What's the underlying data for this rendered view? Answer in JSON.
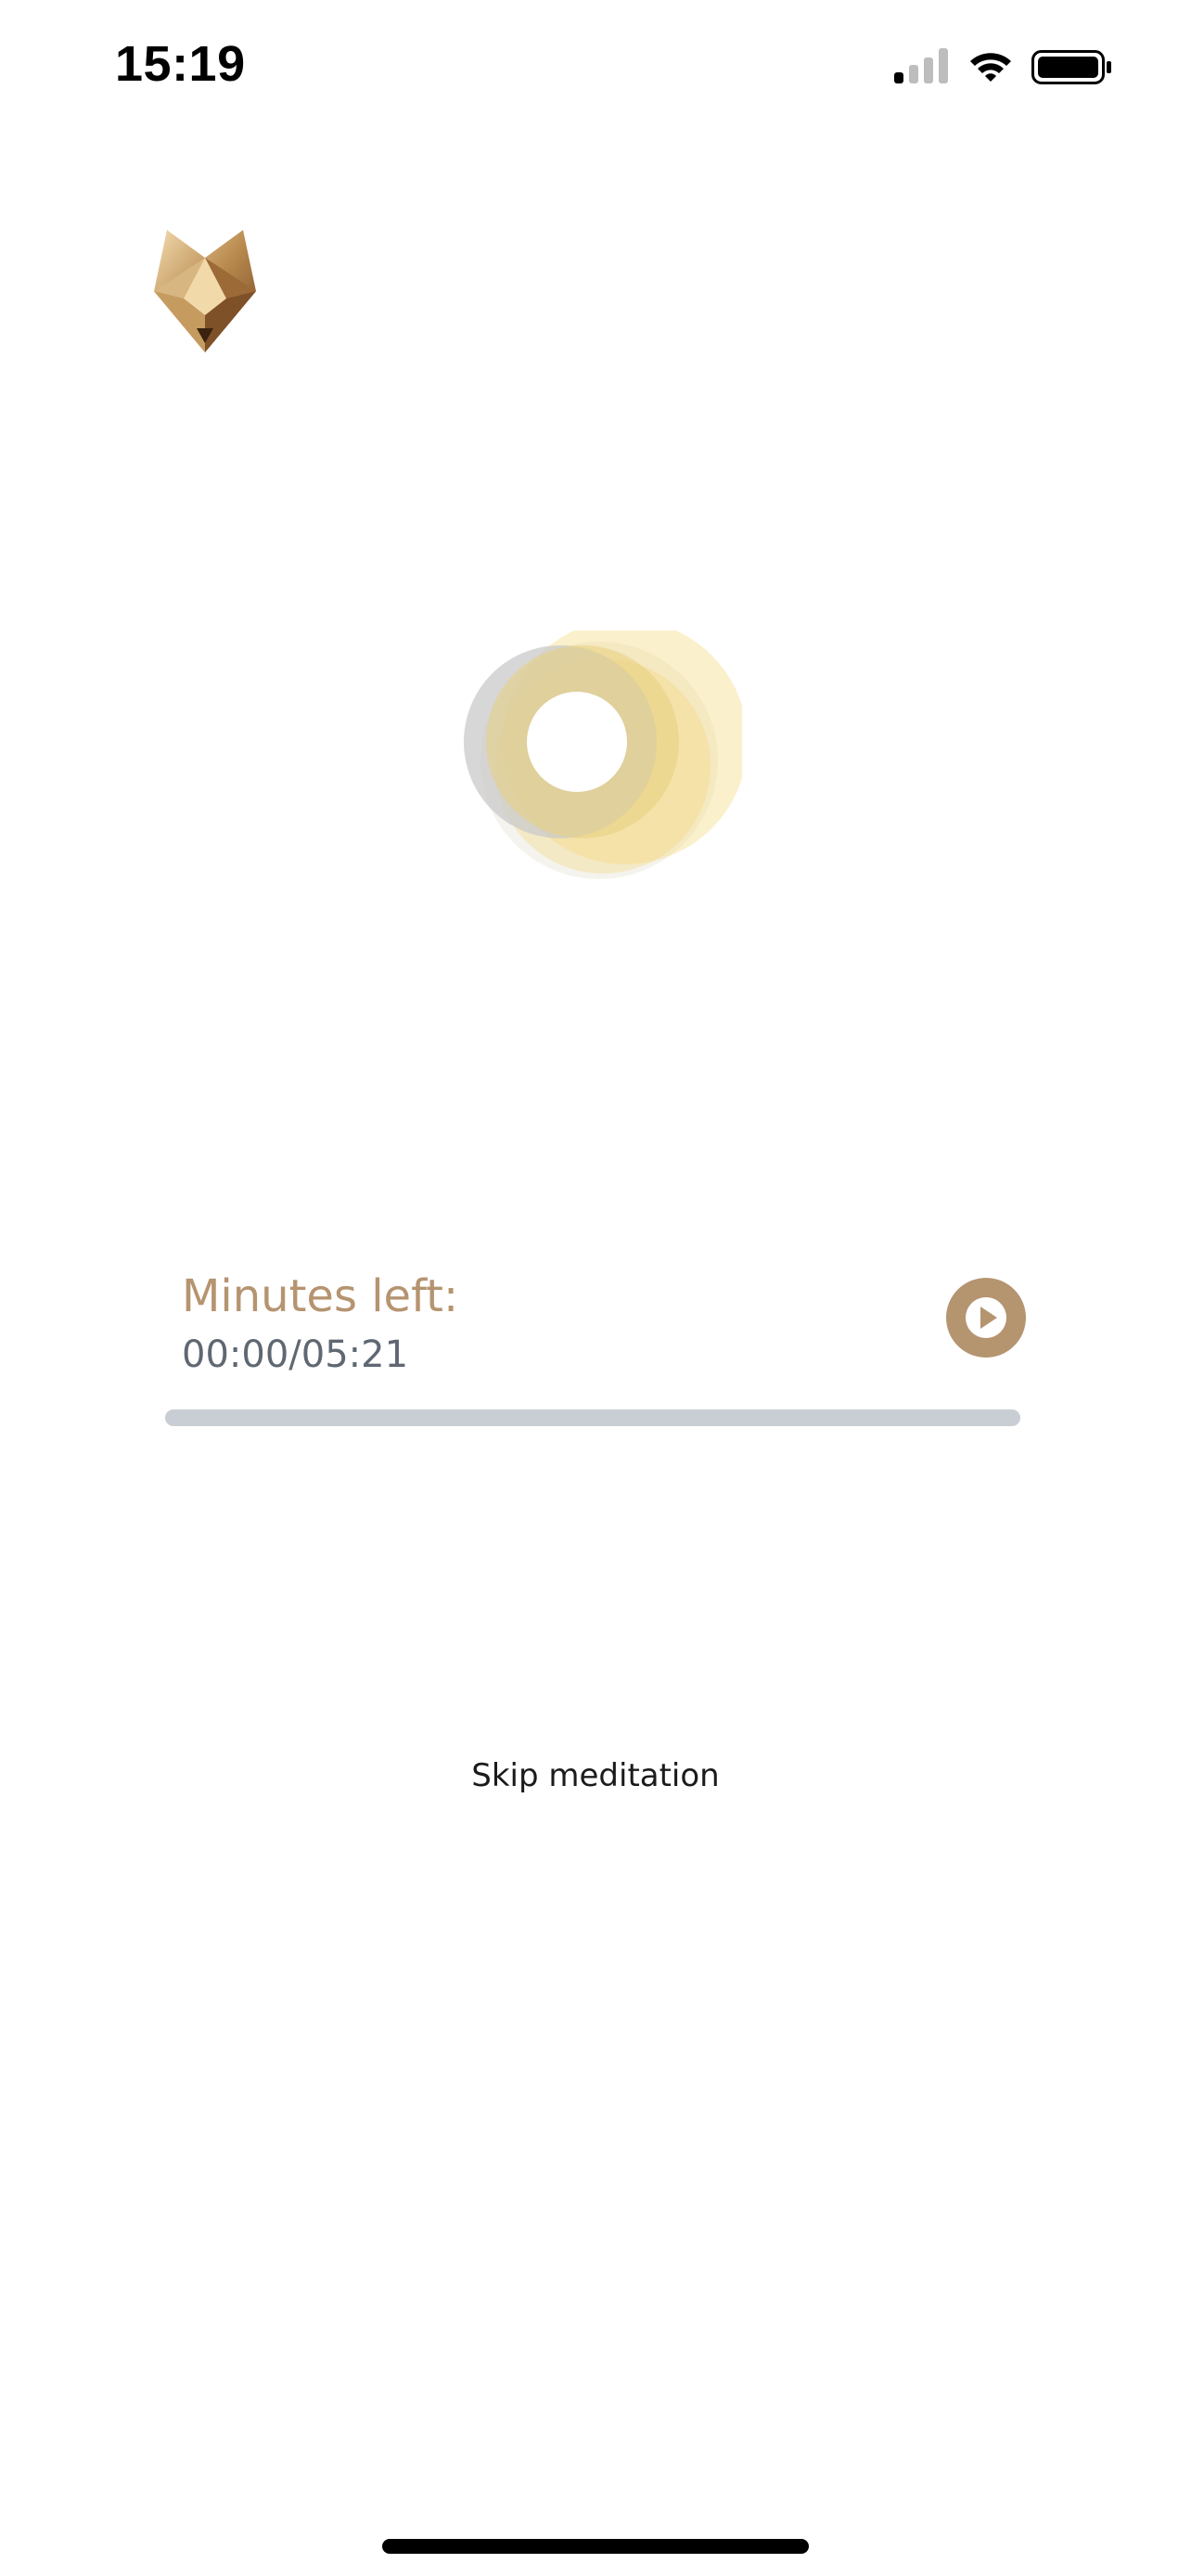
{
  "status_bar": {
    "time": "15:19",
    "icons": [
      "cellular-signal-icon",
      "wifi-icon",
      "battery-icon"
    ]
  },
  "logo": {
    "icon": "fox-logo-icon"
  },
  "player": {
    "minutes_label": "Minutes left:",
    "time_readout": "00:00/05:21",
    "progress": 0,
    "play_icon": "play-icon"
  },
  "skip": {
    "label": "Skip meditation"
  },
  "colors": {
    "accent": "#b59470",
    "track": "#c8ced3",
    "orb_gold": "#f4d67c",
    "orb_grey": "#c9c9c9",
    "time_text": "#5f6872"
  }
}
